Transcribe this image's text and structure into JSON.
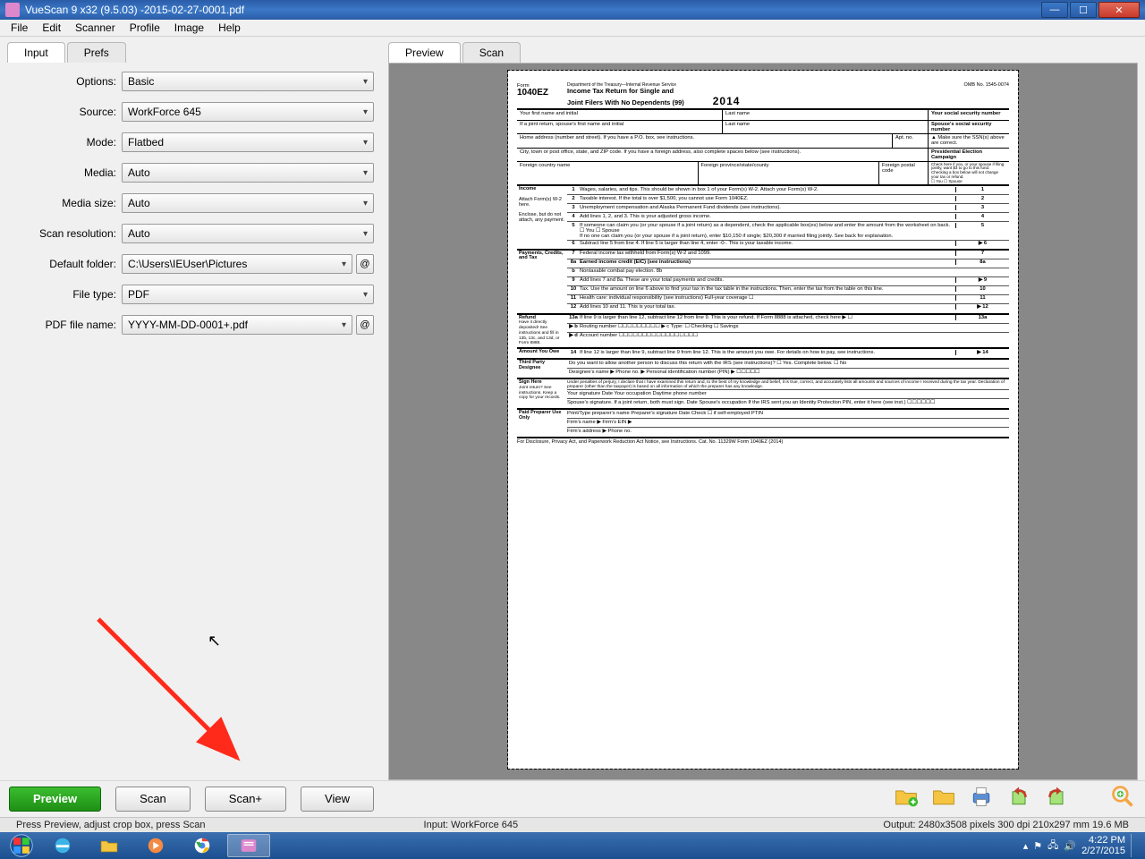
{
  "titlebar": {
    "title": "VueScan 9 x32 (9.5.03) -2015-02-27-0001.pdf"
  },
  "menubar": [
    "File",
    "Edit",
    "Scanner",
    "Profile",
    "Image",
    "Help"
  ],
  "left_tabs": {
    "input": "Input",
    "prefs": "Prefs"
  },
  "fields": {
    "options": {
      "label": "Options:",
      "value": "Basic"
    },
    "source": {
      "label": "Source:",
      "value": "WorkForce 645"
    },
    "mode": {
      "label": "Mode:",
      "value": "Flatbed"
    },
    "media": {
      "label": "Media:",
      "value": "Auto"
    },
    "mediasize": {
      "label": "Media size:",
      "value": "Auto"
    },
    "scanres": {
      "label": "Scan resolution:",
      "value": "Auto"
    },
    "folder": {
      "label": "Default folder:",
      "value": "C:\\Users\\IEUser\\Pictures"
    },
    "filetype": {
      "label": "File type:",
      "value": "PDF"
    },
    "pdfname": {
      "label": "PDF file name:",
      "value": "YYYY-MM-DD-0001+.pdf"
    }
  },
  "right_tabs": {
    "preview": "Preview",
    "scan": "Scan"
  },
  "buttons": {
    "preview": "Preview",
    "scan": "Scan",
    "scanplus": "Scan+",
    "view": "View"
  },
  "status": {
    "left": "Press Preview, adjust crop box, press Scan",
    "mid": "Input: WorkForce 645",
    "right": "Output: 2480x3508 pixels 300 dpi 210x297 mm 19.6 MB"
  },
  "taskbar": {
    "time": "4:22 PM",
    "date": "2/27/2015"
  },
  "doc": {
    "dept": "Department of the Treasury—Internal Revenue Service",
    "formword": "Form",
    "formno": "1040EZ",
    "title1": "Income Tax Return for Single and",
    "title2": "Joint Filers With No Dependents  (99)",
    "year": "2014",
    "omb": "OMB No. 1545-0074",
    "name_first": "Your first name and initial",
    "name_last": "Last name",
    "ssn": "Your social security number",
    "spouse_first": "If a joint return, spouse's first name and initial",
    "spouse_last": "Last name",
    "spouse_ssn": "Spouse's social security number",
    "addr": "Home address (number and street). If you have a P.O. box, see instructions.",
    "aptno": "Apt. no.",
    "ssn_note": "▲ Make sure the SSN(s) above are correct.",
    "city": "City, town or post office, state, and ZIP code. If you have a foreign address, also complete spaces below (see instructions).",
    "foreign_ctry": "Foreign country name",
    "foreign_prov": "Foreign province/state/county",
    "foreign_post": "Foreign postal code",
    "pec_title": "Presidential Election Campaign",
    "pec_txt": "Check here if you, or your spouse if filing jointly, want $3 to go to this fund. Checking a box below will not change your tax or refund.",
    "pec_you": "☐ You   ☐ Spouse",
    "sec_income": "Income",
    "attach": "Attach Form(s) W-2 here.",
    "enclose": "Enclose, but do not attach, any payment.",
    "l1": "Wages, salaries, and tips. This should be shown in box 1 of your Form(s) W-2. Attach your Form(s) W-2.",
    "l2": "Taxable interest. If the total is over $1,500, you cannot use Form 1040EZ.",
    "l3": "Unemployment compensation and Alaska Permanent Fund dividends (see instructions).",
    "l4": "Add lines 1, 2, and 3. This is your adjusted gross income.",
    "l5": "If someone can claim you (or your spouse if a joint return) as a dependent, check the applicable box(es) below and enter the amount from the worksheet on back.",
    "l5b": "☐ You        ☐ Spouse",
    "l5c": "If no one can claim you (or your spouse if a joint return), enter $10,150 if single; $20,300 if married filing jointly. See back for explanation.",
    "l6": "Subtract line 5 from line 4. If line 5 is larger than line 4, enter -0-. This is your taxable income.",
    "sec_pay": "Payments, Credits, and Tax",
    "l7": "Federal income tax withheld from Form(s) W-2 and 1099.",
    "l8a": "Earned income credit (EIC) (see instructions)",
    "l8b": "Nontaxable combat pay election.               8b",
    "l9": "Add lines 7 and 8a. These are your total payments and credits.",
    "l10": "Tax. Use the amount on line 6 above to find your tax in the tax table in the instructions. Then, enter the tax from the table on this line.",
    "l11": "Health care: individual responsibility (see instructions)      Full-year coverage ☐",
    "l12": "Add lines 10 and 11. This is your total tax.",
    "sec_refund": "Refund",
    "refund_side": "Have it directly deposited! See instructions and fill in 13b, 13c, and 13d, or Form 8888.",
    "l13a": "If line 9 is larger than line 12, subtract line 12 from line 9. This is your refund. If Form 8888 is attached, check here ▶ ☐",
    "l13b": "Routing number  ☐☐☐☐☐☐☐☐☐   ▶ c Type:  ☐ Checking  ☐ Savings",
    "l13d": "Account number  ☐☐☐☐☐☐☐☐☐☐☐☐☐☐☐☐☐",
    "sec_owe": "Amount You Owe",
    "l14": "If line 12 is larger than line 9, subtract line 9 from line 12. This is the amount you owe. For details on how to pay, see instructions.",
    "sec_tpd": "Third Party Designee",
    "tpd": "Do you want to allow another person to discuss this return with the IRS (see instructions)?   ☐ Yes. Complete below.   ☐ No",
    "tpd_l": "Designee's name ▶            Phone no. ▶            Personal identification number (PIN) ▶ ☐☐☐☐☐",
    "sec_sign": "Sign Here",
    "sign_side": "Joint return? See instructions. Keep a copy for your records.",
    "sign_perjury": "Under penalties of perjury, I declare that I have examined this return and, to the best of my knowledge and belief, it is true, correct, and accurately lists all amounts and sources of income I received during the tax year. Declaration of preparer (other than the taxpayer) is based on all information of which the preparer has any knowledge.",
    "sign_r1": "Your signature                              Date        Your occupation                       Daytime phone number",
    "sign_r2": "Spouse's signature. If a joint return, both must sign.   Date   Spouse's occupation    If the IRS sent you an Identity Protection PIN, enter it here (see inst.) ☐☐☐☐☐☐",
    "sec_prep": "Paid Preparer Use Only",
    "prep_r1": "Print/Type preparer's name     Preparer's signature            Date        Check ☐ if self-employed    PTIN",
    "prep_r2": "Firm's name ▶                                         Firm's EIN ▶",
    "prep_r3": "Firm's address ▶                                      Phone no.",
    "footer": "For Disclosure, Privacy Act, and Paperwork Reduction Act Notice, see Instructions.          Cat. No. 11329W          Form 1040EZ (2014)"
  }
}
